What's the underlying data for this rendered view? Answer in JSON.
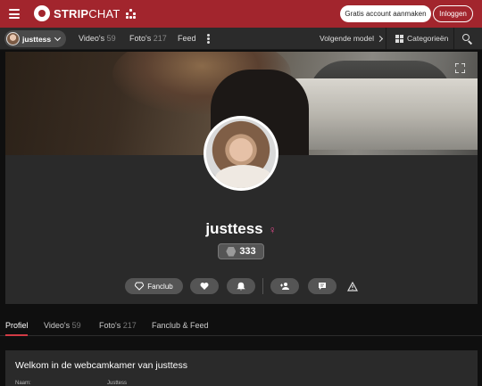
{
  "header": {
    "brand_bold": "STRIP",
    "brand_thin": "CHAT",
    "signup_label": "Gratis account aanmaken",
    "login_label": "Inloggen",
    "color": "#a2252d"
  },
  "nav": {
    "model_name": "justtess",
    "videos_label": "Video's",
    "videos_count": "59",
    "photos_label": "Foto's",
    "photos_count": "217",
    "feed_label": "Feed",
    "next_model_label": "Volgende model",
    "categories_label": "Categorieën"
  },
  "profile": {
    "name": "justtess",
    "gender_symbol": "♀",
    "level": "333",
    "fanclub_label": "Fanclub"
  },
  "tabs": {
    "profile": "Profiel",
    "videos": "Video's",
    "videos_count": "59",
    "photos": "Foto's",
    "photos_count": "217",
    "fanclub_feed": "Fanclub & Feed"
  },
  "welcome": {
    "title": "Welkom in de webcamkamer van justtess",
    "field_label": "Naam:",
    "field_value": "Justtess"
  },
  "icons": [
    "hamburger-icon",
    "stripchat-logo-icon",
    "grid-icon",
    "chevron-down-icon",
    "kebab-icon",
    "chevron-right-icon",
    "categories-icon",
    "search-icon",
    "expand-icon",
    "female-icon",
    "level-icon",
    "diamond-icon",
    "heart-icon",
    "bell-icon",
    "add-user-icon",
    "message-icon",
    "warning-icon"
  ]
}
